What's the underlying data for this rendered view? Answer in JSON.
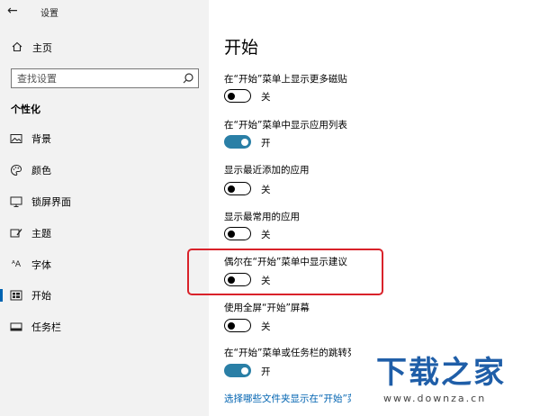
{
  "window": {
    "title": "设置",
    "back_glyph": "←"
  },
  "sidebar": {
    "home_label": "主页",
    "search_placeholder": "查找设置",
    "section_title": "个性化",
    "items": [
      {
        "label": "背景",
        "icon": "picture-icon",
        "glyph": "▨"
      },
      {
        "label": "颜色",
        "icon": "palette-icon",
        "glyph": "✿"
      },
      {
        "label": "锁屏界面",
        "icon": "monitor-icon",
        "glyph": "▭"
      },
      {
        "label": "主题",
        "icon": "theme-brush-icon",
        "glyph": "✎"
      },
      {
        "label": "字体",
        "icon": "font-icon",
        "glyph": "ᴬA"
      },
      {
        "label": "开始",
        "icon": "start-menu-icon",
        "glyph": "▦",
        "active": true
      },
      {
        "label": "任务栏",
        "icon": "taskbar-icon",
        "glyph": "▬"
      }
    ]
  },
  "main": {
    "title": "开始",
    "settings": [
      {
        "label": "在“开始”菜单上显示更多磁贴",
        "state": "关",
        "on": false
      },
      {
        "label": "在“开始”菜单中显示应用列表",
        "state": "开",
        "on": true
      },
      {
        "label": "显示最近添加的应用",
        "state": "关",
        "on": false
      },
      {
        "label": "显示最常用的应用",
        "state": "关",
        "on": false
      },
      {
        "label": "偶尔在“开始”菜单中显示建议",
        "state": "关",
        "on": false
      },
      {
        "label": "使用全屏“开始”屏幕",
        "state": "关",
        "on": false
      },
      {
        "label": "在“开始”菜单或任务栏的跳转列",
        "state": "开",
        "on": true
      }
    ],
    "link_text": "选择哪些文件夹显示在“开始”菜"
  },
  "watermark": {
    "logo": "下载之家",
    "url": "www.downza.cn"
  },
  "colors": {
    "accent": "#0063b1",
    "toggle_on": "#2a7fa6",
    "highlight": "#d9222a",
    "sidebar_bg": "#f2f2f2"
  }
}
